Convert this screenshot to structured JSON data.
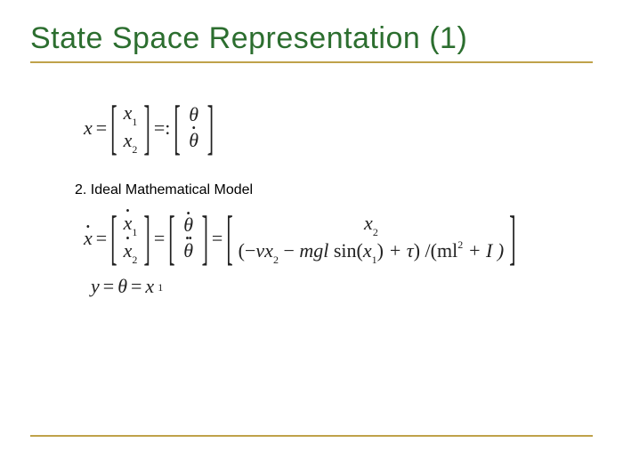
{
  "title": "State Space Representation  (1)",
  "section": "2.  Ideal Mathematical Model",
  "eq1": {
    "lhs": "x",
    "eq": "=",
    "v1a": "x",
    "v1a_sub": "1",
    "v1b": "x",
    "v1b_sub": "2",
    "mid": "=:",
    "v2a": "θ",
    "v2b": "θ"
  },
  "eq2": {
    "lhs": "x",
    "eq": "=",
    "c1a": "x",
    "c1a_sub": "1",
    "c1b": "x",
    "c1b_sub": "2",
    "c2a": "θ",
    "c2b": "θ",
    "rhs_top": "x",
    "rhs_top_sub": "2",
    "rhs_bot_open": "(−",
    "rhs_bot_nu": "ν",
    "rhs_bot_x2": "x",
    "rhs_bot_x2_sub": "2",
    "rhs_bot_minus": " − ",
    "rhs_bot_mgl": "mgl",
    "rhs_bot_sin": " sin(",
    "rhs_bot_x1": "x",
    "rhs_bot_x1_sub": "1",
    "rhs_bot_close1": ")",
    "rhs_bot_plus_tau": " + τ",
    "rhs_bot_close2": ") /",
    "rhs_bot_ml": "(ml",
    "rhs_bot_sup": "2",
    "rhs_bot_plus_I": " + I )"
  },
  "eq3": {
    "text_y": "y",
    "eq1": " = ",
    "theta": "θ",
    "eq2": " = ",
    "x": "x",
    "sub": "1"
  }
}
